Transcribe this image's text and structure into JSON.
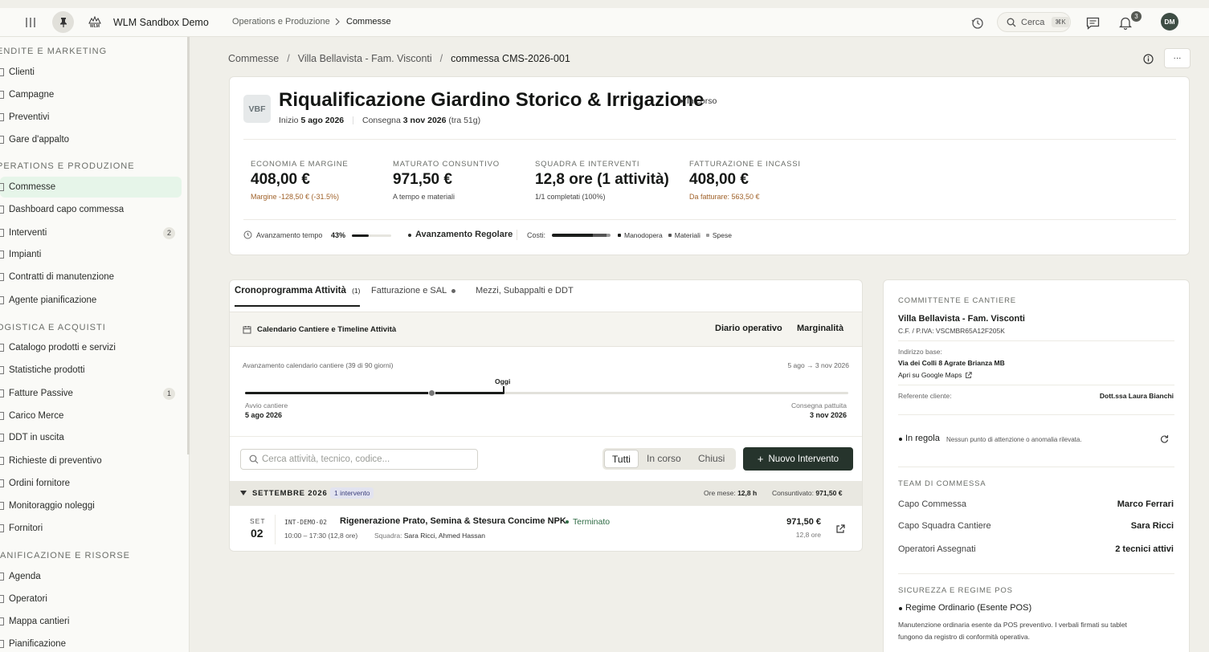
{
  "app": {
    "name": "WLM Sandbox Demo",
    "logo_text": "WLM",
    "breadcrumb_section": "Operations e Produzione",
    "breadcrumb_page": "Commesse",
    "search_label": "Cerca",
    "search_shortcut": "⌘K",
    "notifications_count": "3",
    "avatar_initials": "DM"
  },
  "sidebar": {
    "sections": [
      {
        "title": "ENDITE E MARKETING",
        "items": [
          "Clienti",
          "Campagne",
          "Preventivi",
          "Gare d'appalto"
        ]
      },
      {
        "title": "PERATIONS E PRODUZIONE",
        "items": [
          "Commesse",
          "Dashboard capo commessa",
          "Interventi",
          "Impianti",
          "Contratti di manutenzione",
          "Agente pianificazione"
        ]
      },
      {
        "title": "OGISTICA E ACQUISTI",
        "items": [
          "Catalogo prodotti e servizi",
          "Statistiche prodotti",
          "Fatture Passive",
          "Carico Merce",
          "DDT in uscita",
          "Richieste di preventivo",
          "Ordini fornitore",
          "Monitoraggio noleggi",
          "Fornitori"
        ]
      },
      {
        "title": "IANIFICAZIONE E RISORSE",
        "items": [
          "Agenda",
          "Operatori",
          "Mappa cantieri",
          "Pianificazione"
        ]
      }
    ],
    "badge_interventi": "2",
    "badge_fatture": "1"
  },
  "crumbs": {
    "c1": "Commesse",
    "c2": "Villa Bellavista - Fam. Visconti",
    "c3": "commessa CMS-2026-001",
    "sep": "/",
    "more": "···"
  },
  "header": {
    "initials": "VBF",
    "title": "Riqualificazione Giardino Storico & Irrigazione",
    "status": "In corso",
    "start_label": "Inizio",
    "start_date": "5 ago 2026",
    "end_label": "Consegna",
    "end_date": "3 nov 2026",
    "end_suffix": "(tra 51g)"
  },
  "kpis": [
    {
      "label": "ECONOMIA E MARGINE",
      "value": "408,00 €",
      "sub": "Margine -128,50 € (-31.5%)"
    },
    {
      "label": "MATURATO CONSUNTIVO",
      "value": "971,50 €",
      "sub": "A tempo e materiali"
    },
    {
      "label": "SQUADRA E INTERVENTI",
      "value": "12,8 ore (1 attività)",
      "sub": "1/1 completati (100%)"
    },
    {
      "label": "FATTURAZIONE E INCASSI",
      "value": "408,00 €",
      "sub": "Da fatturare: 563,50 €"
    }
  ],
  "progress": {
    "time_label": "Avanzamento tempo",
    "time_pct": "43%",
    "time_value": 0.43,
    "status": "Avanzamento Regolare",
    "costs_label": "Costi:",
    "legend": [
      "Manodopera",
      "Materiali",
      "Spese"
    ]
  },
  "tabs": {
    "t1": "Cronoprogramma Attività",
    "t1_count": "(1)",
    "t2": "Fatturazione e SAL",
    "t3": "Mezzi, Subappalti e DDT"
  },
  "calendar": {
    "title": "Calendario Cantiere e Timeline Attività",
    "diario": "Diario operativo",
    "marginalita": "Marginalità",
    "progress_text": "Avanzamento calendario cantiere (39 di 90 giorni)",
    "range": "5 ago → 3 nov 2026",
    "today": "Oggi",
    "start_label": "Avvio cantiere",
    "start_date": "5 ago 2026",
    "end_label": "Consegna pattuita",
    "end_date": "3 nov 2026",
    "progress_value": 0.43
  },
  "filters": {
    "search_placeholder": "Cerca attività, tecnico, codice...",
    "all": "Tutti",
    "open": "In corso",
    "closed": "Chiusi",
    "new_button": "Nuovo Intervento"
  },
  "month": {
    "name": "SETTEMBRE 2026",
    "count": "1 intervento",
    "hours_label": "Ore mese:",
    "hours": "12,8 h",
    "cons_label": "Consuntivato:",
    "cons": "971,50 €"
  },
  "intervention": {
    "month": "SET",
    "day": "02",
    "code": "INT-DEMO-02",
    "title": "Rigenerazione Prato, Semina & Stesura Concime NPK",
    "status": "Terminato",
    "time": "10:00 – 17:30 (12,8 ore)",
    "team_label": "Squadra:",
    "team": "Sara Ricci, Ahmed Hassan",
    "amount": "971,50 €",
    "hours": "12,8 ore"
  },
  "side": {
    "section1": "COMMITTENTE E CANTIERE",
    "client": "Villa Bellavista - Fam. Visconti",
    "vat": "C.F. / P.IVA: VSCMBR65A12F205K",
    "address_label": "Indirizzo base:",
    "address": "Via dei Colli 8 Agrate Brianza MB",
    "maps": "Apri su Google Maps",
    "referente_label": "Referente cliente:",
    "referente": "Dott.ssa Laura Bianchi",
    "regola": "In regola",
    "regola_sub": "Nessun punto di attenzione o anomalia rilevata.",
    "section2": "TEAM DI COMMESSA",
    "capo_label": "Capo Commessa",
    "capo": "Marco Ferrari",
    "squadra_label": "Capo Squadra Cantiere",
    "squadra": "Sara Ricci",
    "operatori_label": "Operatori Assegnati",
    "operatori": "2 tecnici attivi",
    "section3": "SICUREZZA E REGIME POS",
    "pos": "Regime Ordinario (Esente POS)",
    "pos_sub1": "Manutenzione ordinaria esente da POS preventivo. I verbali firmati su tablet",
    "pos_sub2": "fungono da registro di conformità operativa."
  },
  "colors": {
    "accent_dark": "#26342c",
    "active_bg": "#e6f5e9",
    "status_green": "#2f6b45",
    "warn_orange": "#a0622a"
  }
}
